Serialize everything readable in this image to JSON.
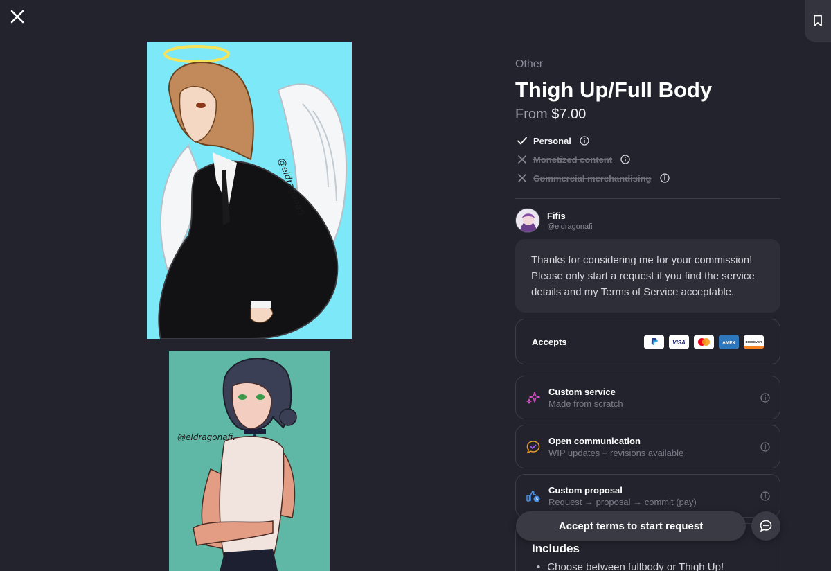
{
  "service": {
    "category": "Other",
    "title": "Thigh Up/Full Body",
    "price_prefix": "From",
    "price": "$7.00"
  },
  "licenses": [
    {
      "label": "Personal",
      "allowed": true
    },
    {
      "label": "Monetized content",
      "allowed": false
    },
    {
      "label": "Commercial merchandising",
      "allowed": false
    }
  ],
  "artist": {
    "name": "Fifis",
    "handle": "@eldragonafi"
  },
  "message": "Thanks for considering me for your commission! Please only start a request if you find the service details and my Terms of Service acceptable.",
  "accepts": {
    "label": "Accepts",
    "methods": [
      "PayPal",
      "VISA",
      "Mastercard",
      "AMEX",
      "DISCOVER"
    ]
  },
  "features": [
    {
      "title": "Custom service",
      "subtitle": "Made from scratch",
      "icon": "sparkles-icon"
    },
    {
      "title": "Open communication",
      "subtitle": "WIP updates + revisions available",
      "icon": "chat-check-icon"
    },
    {
      "title": "Custom proposal",
      "subtitle": "Request → proposal → commit (pay)",
      "icon": "thumbs-up-clock-icon"
    }
  ],
  "includes": {
    "title": "Includes",
    "items": [
      "Choose between fullbody or Thigh Up!"
    ]
  },
  "cta_label": "Accept terms to start request",
  "colors": {
    "background": "#23232e",
    "card": "#2e2e39",
    "border": "#3d3d49",
    "button": "#3a3a45"
  }
}
